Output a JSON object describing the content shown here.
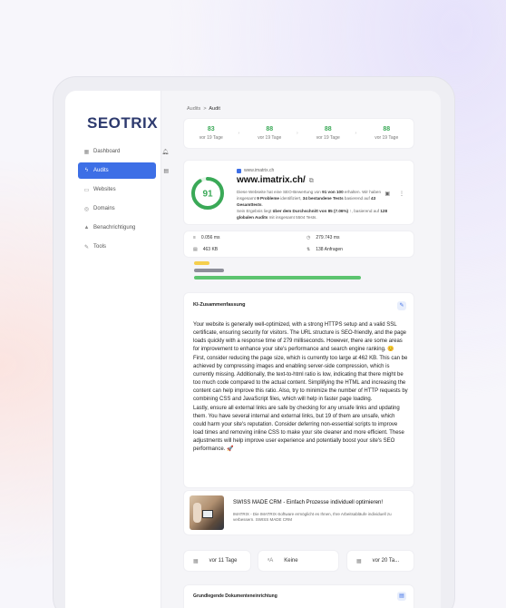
{
  "app": {
    "logo_text": "SEOTRIX"
  },
  "sidebar": {
    "items": [
      {
        "label": "Dashboard",
        "icon": "dashboard-icon",
        "active": false
      },
      {
        "label": "Audits",
        "icon": "bolt-icon",
        "active": true
      },
      {
        "label": "Websites",
        "icon": "monitor-icon",
        "active": false
      },
      {
        "label": "Domains",
        "icon": "globe-icon",
        "active": false
      },
      {
        "label": "Benachrichtigung",
        "icon": "bell-icon",
        "active": false
      },
      {
        "label": "Tools",
        "icon": "tools-icon",
        "active": false
      }
    ]
  },
  "breadcrumb": {
    "parent": "Audits",
    "separator": ">",
    "current": "Audit"
  },
  "history": [
    {
      "score": "83",
      "time": "vor 19 Tage"
    },
    {
      "score": "88",
      "time": "vor 19 Tage"
    },
    {
      "score": "88",
      "time": "vor 19 Tage"
    },
    {
      "score": "88",
      "time": "vor 19 Tage"
    }
  ],
  "site": {
    "score": "91",
    "score_value": 91,
    "score_max": 100,
    "domain_small": "www.imatrix.ch",
    "url": "www.imatrix.ch/",
    "desc_1": "Diese Webseite hat eine SEO-Bewertung von ",
    "desc_1b": "91 von 100",
    "desc_1c": " erhalten. Wir haben insgesamt ",
    "desc_1d": "9 Probleme",
    "desc_1e": " identifiziert, ",
    "desc_1f": "34 bestandene Tests",
    "desc_1g": " basierend auf ",
    "desc_1h": "43 Gesamttests",
    "desc_1i": ".",
    "desc_2": "Sein Ergebnis liegt ",
    "desc_2b": "über dem Durchschnitt von 85 (7.06%)",
    "desc_2c": " ↑, basierend auf ",
    "desc_2d": "128 globalen Audits",
    "desc_2e": " mit insgesamt 5504 Tests.",
    "accent": "#3aa957"
  },
  "stats": {
    "load_time": "0.056 ms",
    "size": "463 KB",
    "words": "279.743 ms",
    "requests": "138 Anfragen"
  },
  "bars": [
    {
      "color": "#f5cf4d",
      "fraction": 0.09
    },
    {
      "color": "#8d8f99",
      "fraction": 0.17
    },
    {
      "color": "#5cc46f",
      "fraction": 0.96
    }
  ],
  "ai": {
    "title": "KI-Zusammenfassung",
    "p1": "Your website is generally well-optimized, with a strong HTTPS setup and a valid SSL certificate, ensuring security for visitors. The URL structure is SEO-friendly, and the page loads quickly with a response time of 279 milliseconds. However, there are some areas for improvement to enhance your site's performance and search engine ranking. 😊",
    "p2": "First, consider reducing the page size, which is currently too large at 462 KB. This can be achieved by compressing images and enabling server-side compression, which is currently missing. Additionally, the text-to-html ratio is low, indicating that there might be too much code compared to the actual content. Simplifying the HTML and increasing the content can help improve this ratio. Also, try to minimize the number of HTTP requests by combining CSS and JavaScript files, which will help in faster page loading.",
    "p3": "Lastly, ensure all external links are safe by checking for any unsafe links and updating them. You have several internal and external links, but 19 of them are unsafe, which could harm your site's reputation. Consider deferring non-essential scripts to improve load times and removing inline CSS to make your site cleaner and more efficient. These adjustments will help improve user experience and potentially boost your site's SEO performance. 🚀"
  },
  "crm": {
    "title": "SWISS MADE CRM - Einfach Prozesse individuell optimieren!",
    "desc": "IMATRIX - Die IMATRIX-Software ermöglicht es Ihnen, Ihre Arbeitsabläufe individuell zu verbessern. SWISS MADE CRM"
  },
  "pills": [
    {
      "label": "vor 11 Tage",
      "icon": "calendar-icon"
    },
    {
      "label": "Keine",
      "icon": "translate-icon"
    },
    {
      "label": "vor 20 Ta...",
      "icon": "calendar-icon"
    }
  ],
  "doc": {
    "title": "Grundlegende Dokumenteneinrichtung"
  }
}
